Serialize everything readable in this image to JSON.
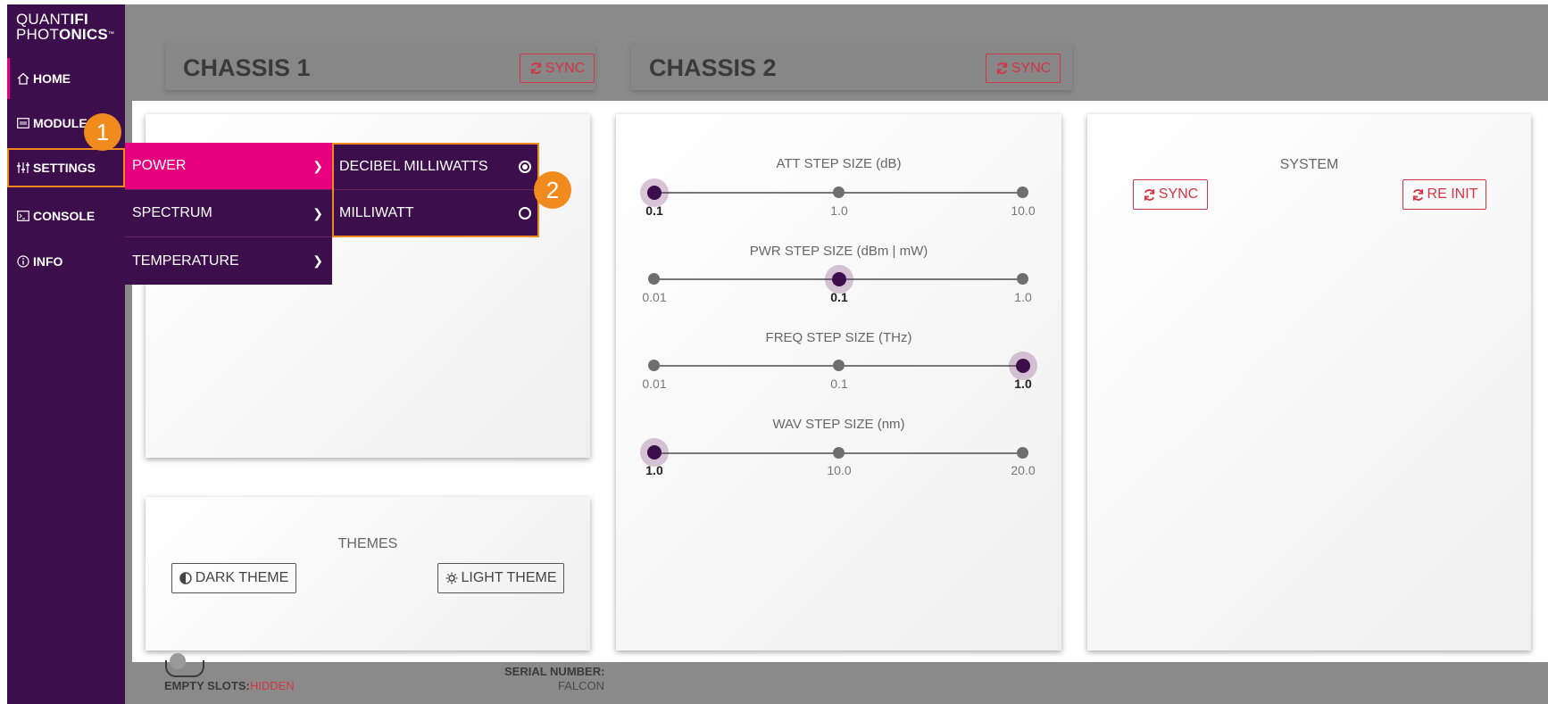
{
  "brand": {
    "line1_light": "QUANT",
    "line1_bold": "IFI",
    "line2_light": "PHOT",
    "line2_bold": "ONICS",
    "tm": "™"
  },
  "sidebar": {
    "items": [
      {
        "label": "HOME",
        "icon": "home-icon"
      },
      {
        "label": "MODULES",
        "icon": "modules-icon"
      },
      {
        "label": "SETTINGS",
        "icon": "sliders-icon"
      },
      {
        "label": "CONSOLE",
        "icon": "console-icon"
      },
      {
        "label": "INFO",
        "icon": "info-icon"
      }
    ]
  },
  "chassis": [
    {
      "title": "CHASSIS 1",
      "sync_label": "SYNC"
    },
    {
      "title": "CHASSIS 2",
      "sync_label": "SYNC"
    }
  ],
  "settings_menu": {
    "items": [
      {
        "label": "POWER",
        "active": true
      },
      {
        "label": "SPECTRUM",
        "active": false
      },
      {
        "label": "TEMPERATURE",
        "active": false
      }
    ],
    "power_options": [
      {
        "label": "DECIBEL MILLIWATTS",
        "selected": true
      },
      {
        "label": "MILLIWATT",
        "selected": false
      }
    ]
  },
  "themes": {
    "title": "THEMES",
    "dark_label": "DARK THEME",
    "light_label": "LIGHT THEME"
  },
  "step_sizes": [
    {
      "label": "ATT STEP SIZE (dB)",
      "ticks": [
        "0.1",
        "1.0",
        "10.0"
      ],
      "selected_index": 0
    },
    {
      "label": "PWR STEP SIZE (dBm | mW)",
      "ticks": [
        "0.01",
        "0.1",
        "1.0"
      ],
      "selected_index": 1
    },
    {
      "label": "FREQ STEP SIZE (THz)",
      "ticks": [
        "0.01",
        "0.1",
        "1.0"
      ],
      "selected_index": 2
    },
    {
      "label": "WAV STEP SIZE (nm)",
      "ticks": [
        "1.0",
        "10.0",
        "20.0"
      ],
      "selected_index": 0
    }
  ],
  "system": {
    "title": "SYSTEM",
    "sync_label": "SYNC",
    "reinit_label": "RE INIT"
  },
  "footer": {
    "empty_slots_label": "EMPTY SLOTS:",
    "empty_slots_value": "HIDDEN",
    "serial_label": "SERIAL NUMBER:",
    "serial_value": "FALCON"
  },
  "annotations": {
    "badge1": "1",
    "badge2": "2"
  },
  "colors": {
    "sidebar": "#3c0e4b",
    "accent_pink": "#e6007e",
    "highlight_orange": "#f28b1e",
    "sync_red": "#d23545"
  }
}
